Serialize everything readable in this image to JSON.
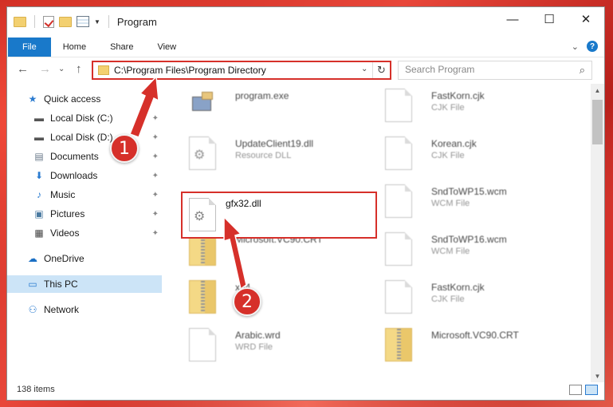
{
  "window": {
    "title": "Program",
    "controls": {
      "minimize": "—",
      "maximize": "☐",
      "close": "✕"
    }
  },
  "ribbon": {
    "tabs": [
      "File",
      "Home",
      "Share",
      "View"
    ],
    "collapse_glyph": "⌄",
    "help_glyph": "?"
  },
  "nav": {
    "back": "←",
    "forward": "→",
    "dropdown": "⌄",
    "up": "↑",
    "address": "C:\\Program Files\\Program Directory",
    "refresh": "↻",
    "search_placeholder": "Search Program"
  },
  "sidebar": {
    "items": [
      {
        "label": "Quick access",
        "icon": "★",
        "pinned": false
      },
      {
        "label": "Local Disk (C:)",
        "icon": "▬",
        "pinned": true
      },
      {
        "label": "Local Disk (D:)",
        "icon": "▬",
        "pinned": true
      },
      {
        "label": "Documents",
        "icon": "▤",
        "pinned": true
      },
      {
        "label": "Downloads",
        "icon": "⬇",
        "pinned": true
      },
      {
        "label": "Music",
        "icon": "♪",
        "pinned": true
      },
      {
        "label": "Pictures",
        "icon": "▣",
        "pinned": true
      },
      {
        "label": "Videos",
        "icon": "▦",
        "pinned": true
      },
      {
        "label": "OneDrive",
        "icon": "☁",
        "pinned": false
      },
      {
        "label": "This PC",
        "icon": "▭",
        "pinned": false
      },
      {
        "label": "Network",
        "icon": "⚇",
        "pinned": false
      }
    ],
    "pin_glyph": "📌"
  },
  "files": {
    "left": [
      {
        "name": "program.exe",
        "type": ""
      },
      {
        "name": "UpdateClient19.dll",
        "type": "Resource DLL"
      },
      {
        "name": "gfx32.dll",
        "type": ""
      },
      {
        "name": "Microsoft.VC90.CRT",
        "type": ""
      },
      {
        "name": "x64",
        "type": ""
      },
      {
        "name": "Arabic.wrd",
        "type": "WRD File"
      }
    ],
    "right": [
      {
        "name": "FastKorn.cjk",
        "type": "CJK File"
      },
      {
        "name": "Korean.cjk",
        "type": "CJK File"
      },
      {
        "name": "SndToWP15.wcm",
        "type": "WCM File"
      },
      {
        "name": "SndToWP16.wcm",
        "type": "WCM File"
      },
      {
        "name": "FastKorn.cjk",
        "type": "CJK File"
      },
      {
        "name": "Microsoft.VC90.CRT",
        "type": ""
      }
    ],
    "gear_glyph": "⚙"
  },
  "status": {
    "count": "138 items"
  },
  "scrollbar": {
    "up": "▲",
    "down": "▼"
  },
  "callouts": {
    "one": "1",
    "two": "2"
  },
  "colors": {
    "accent": "#1979ca",
    "highlight": "#d6302a",
    "selected": "#cce4f7"
  }
}
